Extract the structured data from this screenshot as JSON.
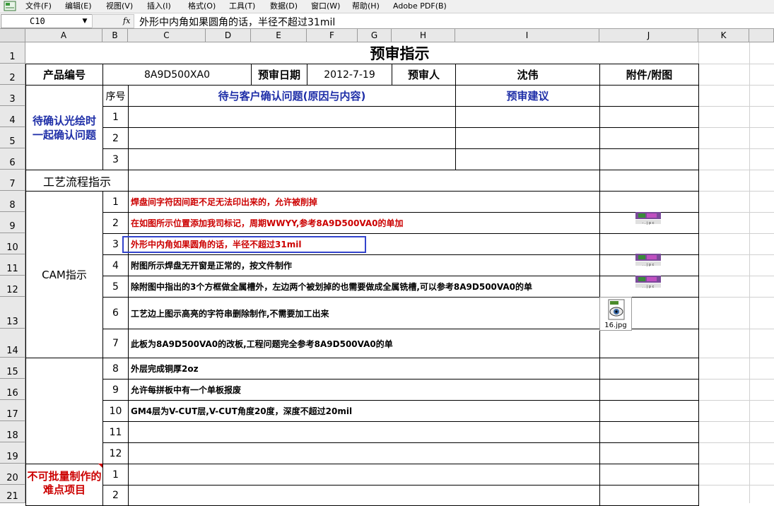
{
  "menu": [
    {
      "id": "file",
      "label": "文件(F)"
    },
    {
      "id": "edit",
      "label": "编辑(E)"
    },
    {
      "id": "view",
      "label": "视图(V)"
    },
    {
      "id": "insert",
      "label": "插入(I)"
    },
    {
      "id": "format",
      "label": "格式(O)"
    },
    {
      "id": "tools",
      "label": "工具(T)"
    },
    {
      "id": "data",
      "label": "数据(D)"
    },
    {
      "id": "window",
      "label": "窗口(W)"
    },
    {
      "id": "help",
      "label": "帮助(H)"
    },
    {
      "id": "adobe",
      "label": "Adobe PDF(B)"
    }
  ],
  "formula_bar": {
    "name_box": "C10",
    "fx_label": "fx",
    "content": "外形中内角如果圆角的话，半径不超过31mil"
  },
  "columns": [
    "A",
    "B",
    "C",
    "D",
    "E",
    "F",
    "G",
    "H",
    "I",
    "J",
    "K"
  ],
  "rows": [
    "1",
    "2",
    "3",
    "4",
    "5",
    "6",
    "7",
    "8",
    "9",
    "10",
    "11",
    "12",
    "13",
    "14",
    "15",
    "16",
    "17",
    "18",
    "19",
    "20",
    "21"
  ],
  "sheet": {
    "title": "预审指示",
    "header": {
      "product_label": "产品编号",
      "product_value": "8A9D500XA0",
      "date_label": "预审日期",
      "date_value": "2012-7-19",
      "reviewer_label": "预审人",
      "reviewer_value": "沈伟",
      "attachment_label": "附件/附图"
    },
    "confirm_section": {
      "label": "待确认光绘时一起确认问题",
      "seq_header": "序号",
      "issue_header": "待与客户确认问题(原因与内容)",
      "advice_header": "预审建议",
      "rows": [
        "1",
        "2",
        "3"
      ]
    },
    "process_label": "工艺流程指示",
    "cam_section": {
      "label": "CAM指示",
      "items": [
        {
          "n": "1",
          "text": "焊盘间字符因间距不足无法印出来的，允许被削掉",
          "red": true
        },
        {
          "n": "2",
          "text": "在如图所示位置添加我司标记，周期WWYY,参考8A9D500VA0的单加",
          "red": true
        },
        {
          "n": "3",
          "text": "外形中内角如果圆角的话，半径不超过31mil",
          "red": true
        },
        {
          "n": "4",
          "text": "附图所示焊盘无开窗是正常的，按文件制作",
          "red": false
        },
        {
          "n": "5",
          "text": "除附图中指出的3个方框做全属槽外，左边两个被划掉的也需要做成全属铣槽,可以参考8A9D500VA0的单",
          "red": false
        },
        {
          "n": "6",
          "text": "工艺边上图示高亮的字符串删除制作,不需要加工出来",
          "red": false
        },
        {
          "n": "7",
          "text": "此板为8A9D500VA0的改板,工程问题完全参考8A9D500VA0的单",
          "red": false
        }
      ]
    },
    "other_items": [
      {
        "n": "8",
        "text": "外层完成铜厚2oz"
      },
      {
        "n": "9",
        "text": "允许每拼板中有一个单板报废"
      },
      {
        "n": "10",
        "text": "GM4层为V-CUT层,V-CUT角度20度，深度不超过20mil"
      },
      {
        "n": "11",
        "text": ""
      },
      {
        "n": "12",
        "text": ""
      }
    ],
    "difficulty_section": {
      "label": "不可批量制作的难点项目",
      "rows": [
        "1",
        "2"
      ]
    },
    "attachments": {
      "jpg_label": "16.jpg"
    }
  },
  "colors": {
    "red": "#cc0000",
    "blue": "#1f2fa8",
    "selection": "#3344cc"
  }
}
